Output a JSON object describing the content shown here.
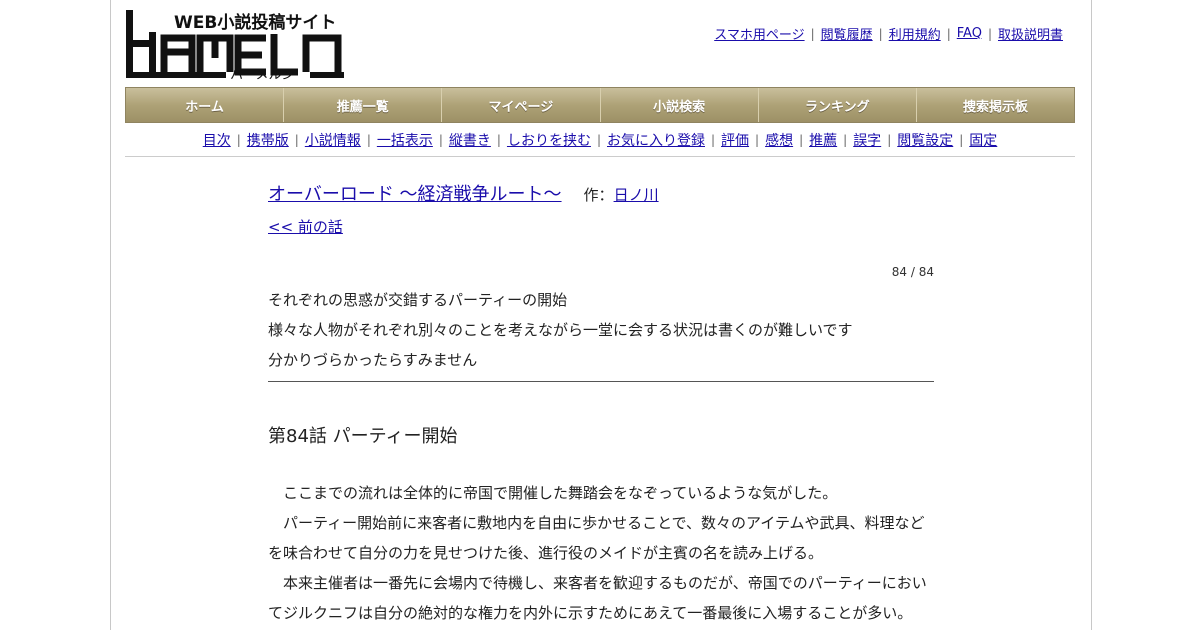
{
  "site": {
    "logo_tagline": "WEB小説投稿サイト",
    "logo_name": "HAMELN",
    "logo_kana": "ハーメルン"
  },
  "toplinks": [
    {
      "label": "スマホ用ページ"
    },
    {
      "label": "閲覧履歴"
    },
    {
      "label": "利用規約"
    },
    {
      "label": "FAQ"
    },
    {
      "label": "取扱説明書"
    }
  ],
  "menu": [
    {
      "label": "ホーム"
    },
    {
      "label": "推薦一覧"
    },
    {
      "label": "マイページ"
    },
    {
      "label": "小説検索"
    },
    {
      "label": "ランキング"
    },
    {
      "label": "捜索掲示板"
    }
  ],
  "subnav": [
    {
      "label": "目次"
    },
    {
      "label": "携帯版"
    },
    {
      "label": "小説情報"
    },
    {
      "label": "一括表示"
    },
    {
      "label": "縦書き"
    },
    {
      "label": "しおりを挟む"
    },
    {
      "label": "お気に入り登録"
    },
    {
      "label": "評価"
    },
    {
      "label": "感想"
    },
    {
      "label": "推薦"
    },
    {
      "label": "誤字"
    },
    {
      "label": "閲覧設定"
    },
    {
      "label": "固定"
    }
  ],
  "novel": {
    "title": "オーバーロード ～経済戦争ルート～",
    "author_prefix": "作：",
    "author": "日ノ川",
    "prev_link": "<< 前の話",
    "page_indicator": "84 / 84",
    "preface": [
      "それぞれの思惑が交錯するパーティーの開始",
      "様々な人物がそれぞれ別々のことを考えながら一堂に会する状況は書くのが難しいです",
      "分かりづらかったらすみません"
    ],
    "chapter_title": "第84話 パーティー開始",
    "paragraphs": [
      "　ここまでの流れは全体的に帝国で開催した舞踏会をなぞっているような気がした。",
      "　パーティー開始前に来客者に敷地内を自由に歩かせることで、数々のアイテムや武具、料理などを味合わせて自分の力を見せつけた後、進行役のメイドが主賓の名を読み上げる。",
      "　本来主催者は一番先に会場内で待機し、来客者を歓迎するものだが、帝国でのパーティーにおいてジルクニフは自分の絶対的な権力を内外に示すためにあえて一番最後に入場することが多い。"
    ]
  }
}
